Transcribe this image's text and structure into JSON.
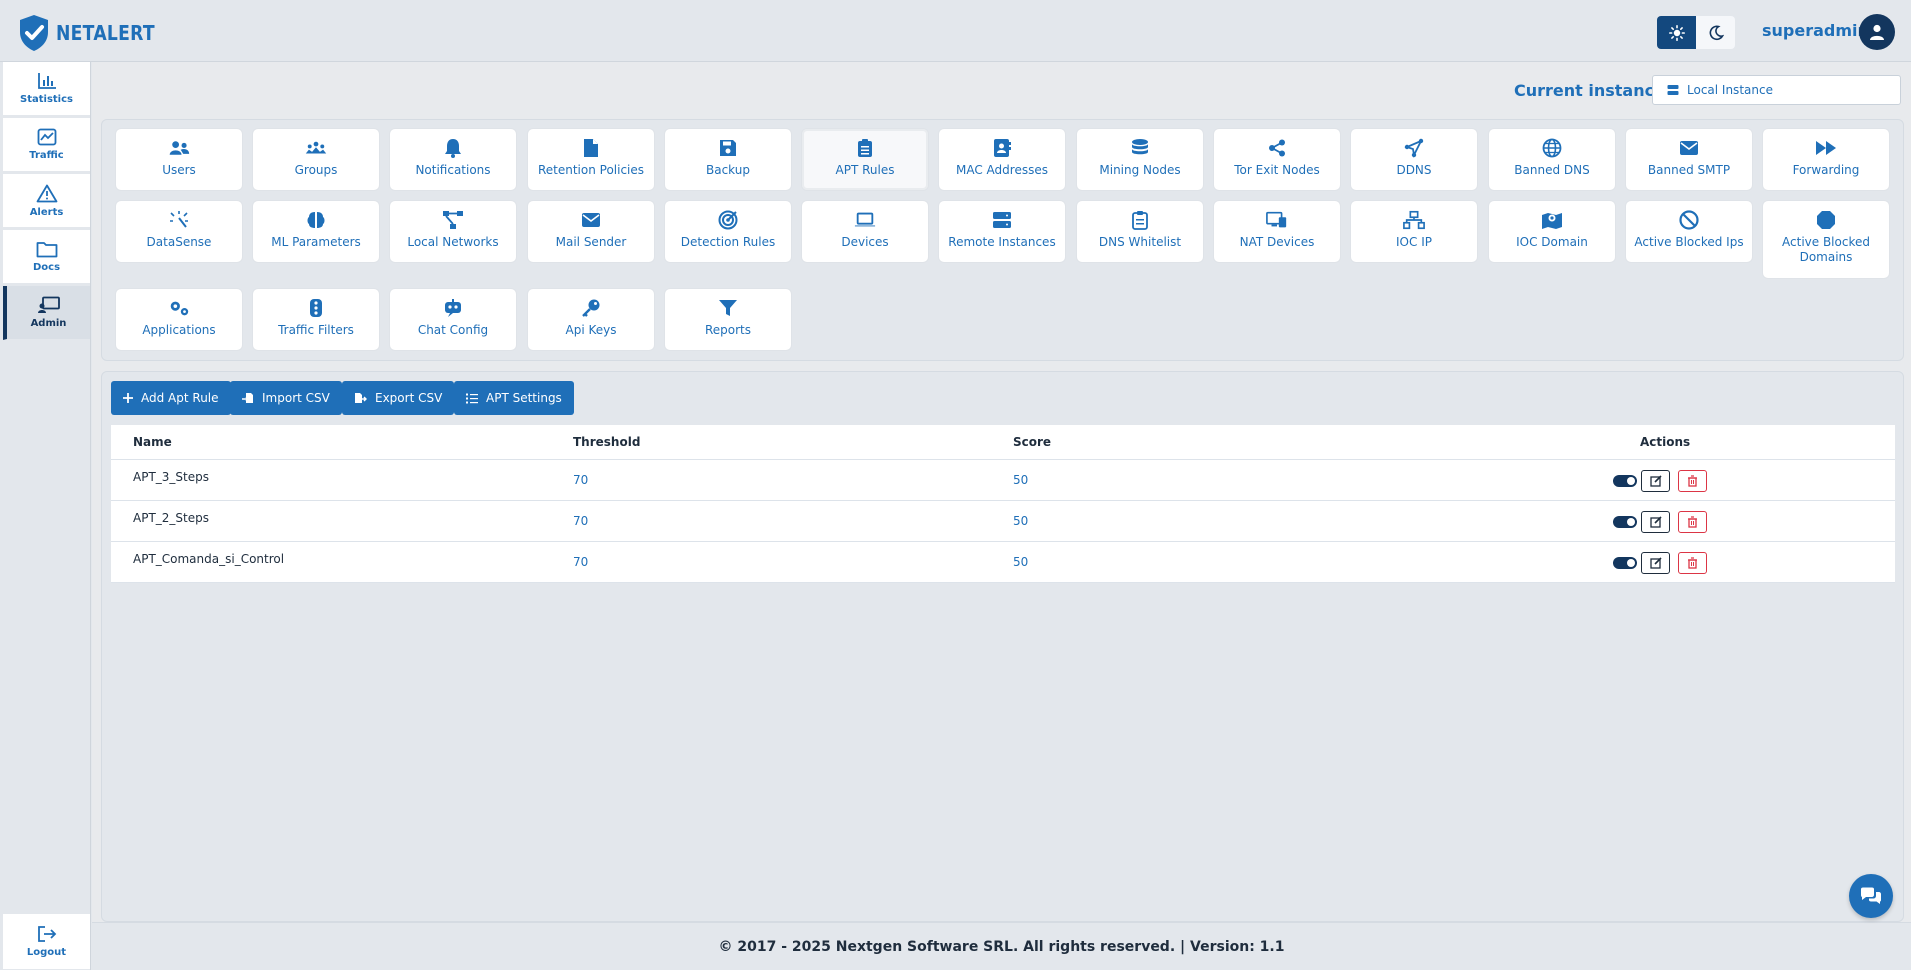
{
  "app": {
    "name": "NETALERT"
  },
  "header": {
    "username": "superadmin",
    "theme": {
      "light": "sun-icon",
      "dark": "moon-icon",
      "active": "light"
    }
  },
  "sidebar": {
    "items": [
      {
        "label": "Statistics",
        "icon": "bar-chart-icon"
      },
      {
        "label": "Traffic",
        "icon": "line-chart-icon"
      },
      {
        "label": "Alerts",
        "icon": "warning-icon"
      },
      {
        "label": "Docs",
        "icon": "folder-icon"
      },
      {
        "label": "Admin",
        "icon": "admin-icon",
        "active": true
      }
    ],
    "logout": "Logout"
  },
  "instance": {
    "label": "Current instance:",
    "value": "Local Instance"
  },
  "tiles": [
    "Users",
    "Groups",
    "Notifications",
    "Retention Policies",
    "Backup",
    "APT Rules",
    "MAC Addresses",
    "Mining Nodes",
    "Tor Exit Nodes",
    "DDNS",
    "Banned DNS",
    "Banned SMTP",
    "Forwarding",
    "DataSense",
    "ML Parameters",
    "Local Networks",
    "Mail Sender",
    "Detection Rules",
    "Devices",
    "Remote Instances",
    "DNS Whitelist",
    "NAT Devices",
    "IOC IP",
    "IOC Domain",
    "Active Blocked Ips",
    "Active Blocked Domains",
    "Applications",
    "Traffic Filters",
    "Chat Config",
    "Api Keys",
    "Reports"
  ],
  "selected_tile": "APT Rules",
  "toolbar": {
    "add": "Add Apt Rule",
    "import": "Import CSV",
    "export": "Export CSV",
    "settings": "APT Settings"
  },
  "table": {
    "columns": [
      "Name",
      "Threshold",
      "Score",
      "Actions"
    ],
    "rows": [
      {
        "name": "APT_3_Steps",
        "threshold": "70",
        "score": "50",
        "enabled": true
      },
      {
        "name": "APT_2_Steps",
        "threshold": "70",
        "score": "50",
        "enabled": true
      },
      {
        "name": "APT_Comanda_si_Control",
        "threshold": "70",
        "score": "50",
        "enabled": true
      }
    ]
  },
  "footer": "© 2017 - 2025 Nextgen Software SRL. All rights reserved. | Version: 1.1",
  "colors": {
    "primary": "#1f6fb8",
    "dark": "#13365e",
    "danger": "#dc3545",
    "background": "#e3e7ec"
  }
}
